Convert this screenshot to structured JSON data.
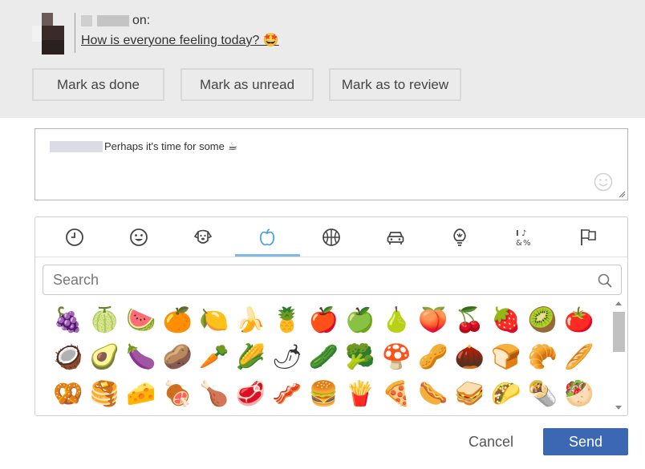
{
  "header": {
    "user_suffix": "on:",
    "thread_link": "How is everyone feeling today? 🤩"
  },
  "actions": {
    "mark_done": "Mark as done",
    "mark_unread": "Mark as unread",
    "mark_review": "Mark as to review"
  },
  "composer": {
    "text": "Perhaps it's time for some",
    "trailing_emoji": "☕"
  },
  "picker": {
    "tabs": [
      {
        "name": "recent",
        "icon": "clock-icon"
      },
      {
        "name": "smileys",
        "icon": "smiley-icon"
      },
      {
        "name": "animals",
        "icon": "dog-icon"
      },
      {
        "name": "food",
        "icon": "apple-icon",
        "active": true
      },
      {
        "name": "activities",
        "icon": "basketball-icon"
      },
      {
        "name": "travel",
        "icon": "car-icon"
      },
      {
        "name": "objects",
        "icon": "lightbulb-icon"
      },
      {
        "name": "symbols",
        "icon": "symbols-icon"
      },
      {
        "name": "flags",
        "icon": "flag-icon"
      }
    ],
    "search_placeholder": "Search",
    "rows": [
      [
        "🍇",
        "🍈",
        "🍉",
        "🍊",
        "🍋",
        "🍌",
        "🍍",
        "🍎",
        "🍏",
        "🍐",
        "🍑",
        "🍒",
        "🍓",
        "🥝",
        "🍅"
      ],
      [
        "🥥",
        "🥑",
        "🍆",
        "🥔",
        "🥕",
        "🌽",
        "🌶",
        "🥒",
        "🥦",
        "🍄",
        "🥜",
        "🌰",
        "🍞",
        "🥐",
        "🥖"
      ],
      [
        "🥨",
        "🥞",
        "🧀",
        "🍖",
        "🍗",
        "🥩",
        "🥓",
        "🍔",
        "🍟",
        "🍕",
        "🌭",
        "🥪",
        "🌮",
        "🌯",
        "🥙"
      ]
    ]
  },
  "footer": {
    "cancel": "Cancel",
    "send": "Send"
  },
  "colors": {
    "accent": "#3c67b3",
    "tab_active": "#7fb9e6",
    "top_bg": "#ebebeb"
  }
}
